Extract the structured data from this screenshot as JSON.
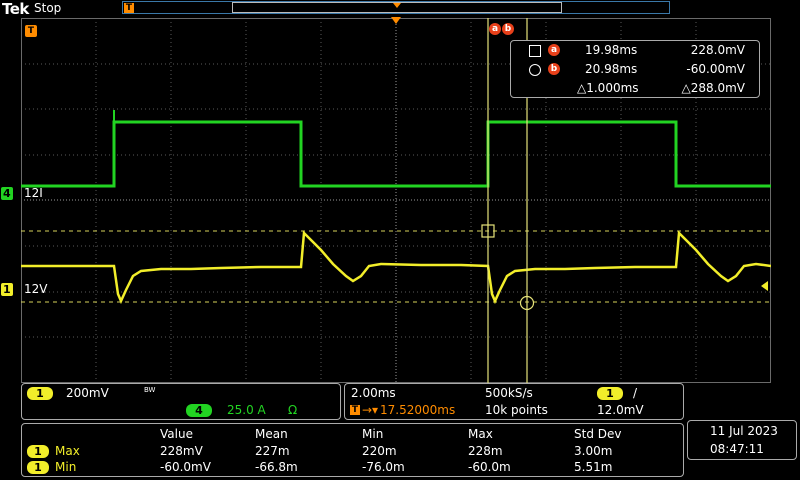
{
  "header": {
    "brand": "Tek",
    "status": "Stop",
    "trigger_marker": "T"
  },
  "cursor_badges": {
    "a": "a",
    "b": "b"
  },
  "cursors": {
    "a": {
      "badge": "a",
      "time": "19.98ms",
      "value": "228.0mV"
    },
    "b": {
      "badge": "b",
      "time": "20.98ms",
      "value": "-60.00mV"
    },
    "delta": {
      "time": "△1.000ms",
      "value": "△288.0mV"
    }
  },
  "channels": {
    "ch4": {
      "number": "4",
      "label": "12I",
      "color": "#22d422"
    },
    "ch1": {
      "number": "1",
      "label": "12V",
      "color": "#f2ee2a"
    }
  },
  "vertical_panel": {
    "ch1_number": "1",
    "ch1_scale": "200mV",
    "bandwidth": "BW",
    "ch4_number": "4",
    "ch4_scale": "25.0 A",
    "ch4_coupling": "Ω"
  },
  "horizontal_panel": {
    "time_scale": "2.00ms",
    "sample_rate": "500kS/s",
    "trigger_source": "1",
    "trigger_slope": "/",
    "trigger_position": "17.52000ms",
    "record_length": "10k points",
    "trigger_level": "12.0mV"
  },
  "measurements": {
    "headers": [
      "Value",
      "Mean",
      "Min",
      "Max",
      "Std Dev"
    ],
    "rows": [
      {
        "channel": "1",
        "name": "Max",
        "values": [
          "228mV",
          "227m",
          "220m",
          "228m",
          "3.00m"
        ]
      },
      {
        "channel": "1",
        "name": "Min",
        "values": [
          "-60.0mV",
          "-66.8m",
          "-76.0m",
          "-60.0m",
          "5.51m"
        ]
      }
    ]
  },
  "datetime": {
    "date": "11 Jul  2023",
    "time": "08:47:11"
  },
  "colors": {
    "ch1": "#f2ee2a",
    "ch4": "#22d422",
    "trigger": "#ff8c00",
    "cursor": "#e8401a",
    "grid": "#5a5a5a"
  }
}
